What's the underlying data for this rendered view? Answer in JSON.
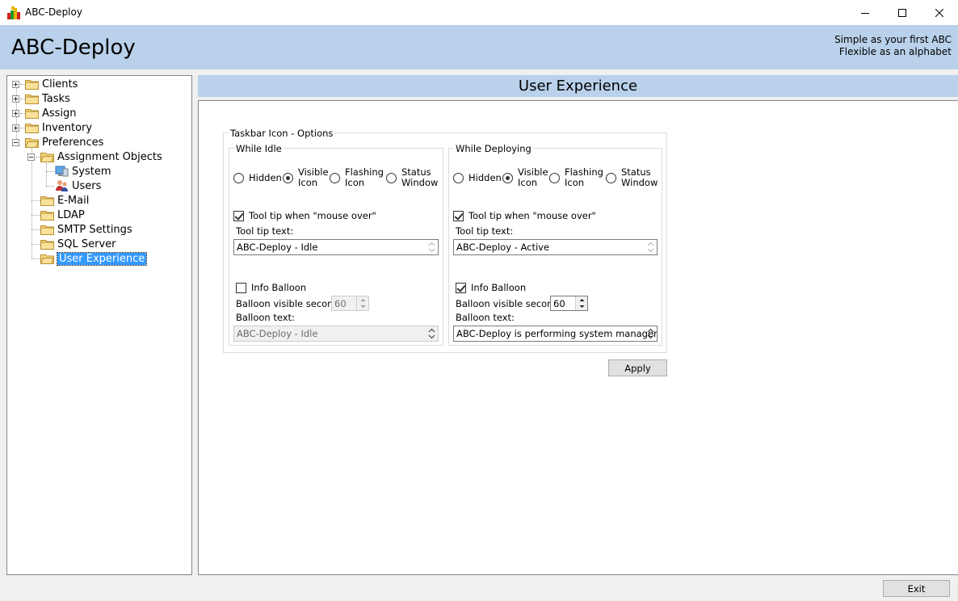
{
  "window": {
    "title": "ABC-Deploy"
  },
  "header": {
    "title": "ABC-Deploy",
    "tagline_1": "Simple as your first ABC",
    "tagline_2": "Flexible as an alphabet"
  },
  "tree": {
    "clients": "Clients",
    "tasks": "Tasks",
    "assign": "Assign",
    "inventory": "Inventory",
    "preferences": "Preferences",
    "assignment_objects": "Assignment Objects",
    "system": "System",
    "users": "Users",
    "email": "E-Mail",
    "ldap": "LDAP",
    "smtp": "SMTP Settings",
    "sql": "SQL Server",
    "user_experience": "User Experience"
  },
  "content": {
    "title": "User Experience",
    "taskbar_group": "Taskbar Icon - Options",
    "idle": {
      "group": "While Idle",
      "radio_hidden": "Hidden",
      "radio_visible_1": "Visible",
      "radio_visible_2": "Icon",
      "radio_flashing_1": "Flashing",
      "radio_flashing_2": "Icon",
      "radio_status_1": "Status",
      "radio_status_2": "Window",
      "tooltip_check": "Tool tip when \"mouse over\"",
      "tooltip_label": "Tool tip text:",
      "tooltip_value": "ABC-Deploy - Idle",
      "balloon_check": "Info Balloon",
      "balloon_seconds_label": "Balloon visible seconds",
      "balloon_seconds_value": "60",
      "balloon_text_label": "Balloon text:",
      "balloon_text_value": "ABC-Deploy - Idle"
    },
    "deploying": {
      "group": "While Deploying",
      "radio_hidden": "Hidden",
      "radio_visible_1": "Visible",
      "radio_visible_2": "Icon",
      "radio_flashing_1": "Flashing",
      "radio_flashing_2": "Icon",
      "radio_status_1": "Status",
      "radio_status_2": "Window",
      "tooltip_check": "Tool tip when \"mouse over\"",
      "tooltip_label": "Tool tip text:",
      "tooltip_value": "ABC-Deploy - Active",
      "balloon_check": "Info Balloon",
      "balloon_seconds_label": "Balloon visible seconds",
      "balloon_seconds_value": "60",
      "balloon_text_label": "Balloon text:",
      "balloon_text_value": "ABC-Deploy is performing system management ta"
    },
    "apply_button": "Apply"
  },
  "footer": {
    "exit_button": "Exit"
  }
}
